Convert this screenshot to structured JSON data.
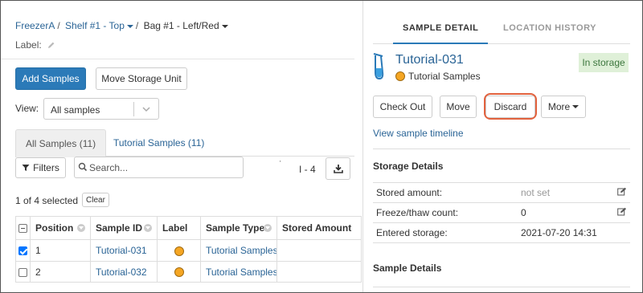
{
  "breadcrumb": {
    "items": [
      "FreezerA",
      "Shelf #1 - Top",
      "Bag #1 - Left/Red"
    ],
    "separator": "/"
  },
  "label_row": {
    "text": "Label:",
    "icon": "pencil-icon"
  },
  "toolbar": {
    "add_samples": "Add Samples",
    "move_storage_unit": "Move Storage Unit"
  },
  "view": {
    "label": "View:",
    "selected": "All samples"
  },
  "tabs": [
    {
      "label": "All Samples (11)",
      "active": true
    },
    {
      "label": "Tutorial Samples (11)",
      "active": false
    }
  ],
  "grid_controls": {
    "filters_label": "Filters",
    "search_placeholder": "Search...",
    "page_info": "I - 4",
    "tick": "'"
  },
  "selection": {
    "text": "1 of 4 selected",
    "clear_label": "Clear"
  },
  "table": {
    "columns": [
      "Position",
      "Sample ID",
      "Label",
      "Sample Type",
      "Stored Amount"
    ],
    "rows": [
      {
        "checked": true,
        "position": "1",
        "sample_id": "Tutorial-031",
        "label_color": "#f5a623",
        "sample_type": "Tutorial Samples",
        "stored_amount": ""
      },
      {
        "checked": false,
        "position": "2",
        "sample_id": "Tutorial-032",
        "label_color": "#f5a623",
        "sample_type": "Tutorial Samples",
        "stored_amount": ""
      }
    ]
  },
  "detail": {
    "tabs": [
      {
        "label": "SAMPLE DETAIL",
        "active": true
      },
      {
        "label": "LOCATION HISTORY",
        "active": false
      }
    ],
    "sample_name": "Tutorial-031",
    "sample_type": "Tutorial Samples",
    "status_badge": "In storage",
    "actions": {
      "check_out": "Check Out",
      "move": "Move",
      "discard": "Discard",
      "more": "More"
    },
    "timeline_link": "View sample timeline",
    "storage_details": {
      "title": "Storage Details",
      "rows": [
        {
          "key": "Stored amount:",
          "value": "not set",
          "editable": true
        },
        {
          "key": "Freeze/thaw count:",
          "value": "0",
          "editable": true
        },
        {
          "key": "Entered storage:",
          "value": "2021-07-20 14:31",
          "editable": false
        }
      ]
    },
    "sample_details": {
      "title": "Sample Details"
    }
  },
  "colors": {
    "primary": "#2b7ab8",
    "link": "#2a6496",
    "badge_bg": "#dff0d8",
    "badge_text": "#3c763d",
    "highlight_ring": "#e2623e"
  }
}
